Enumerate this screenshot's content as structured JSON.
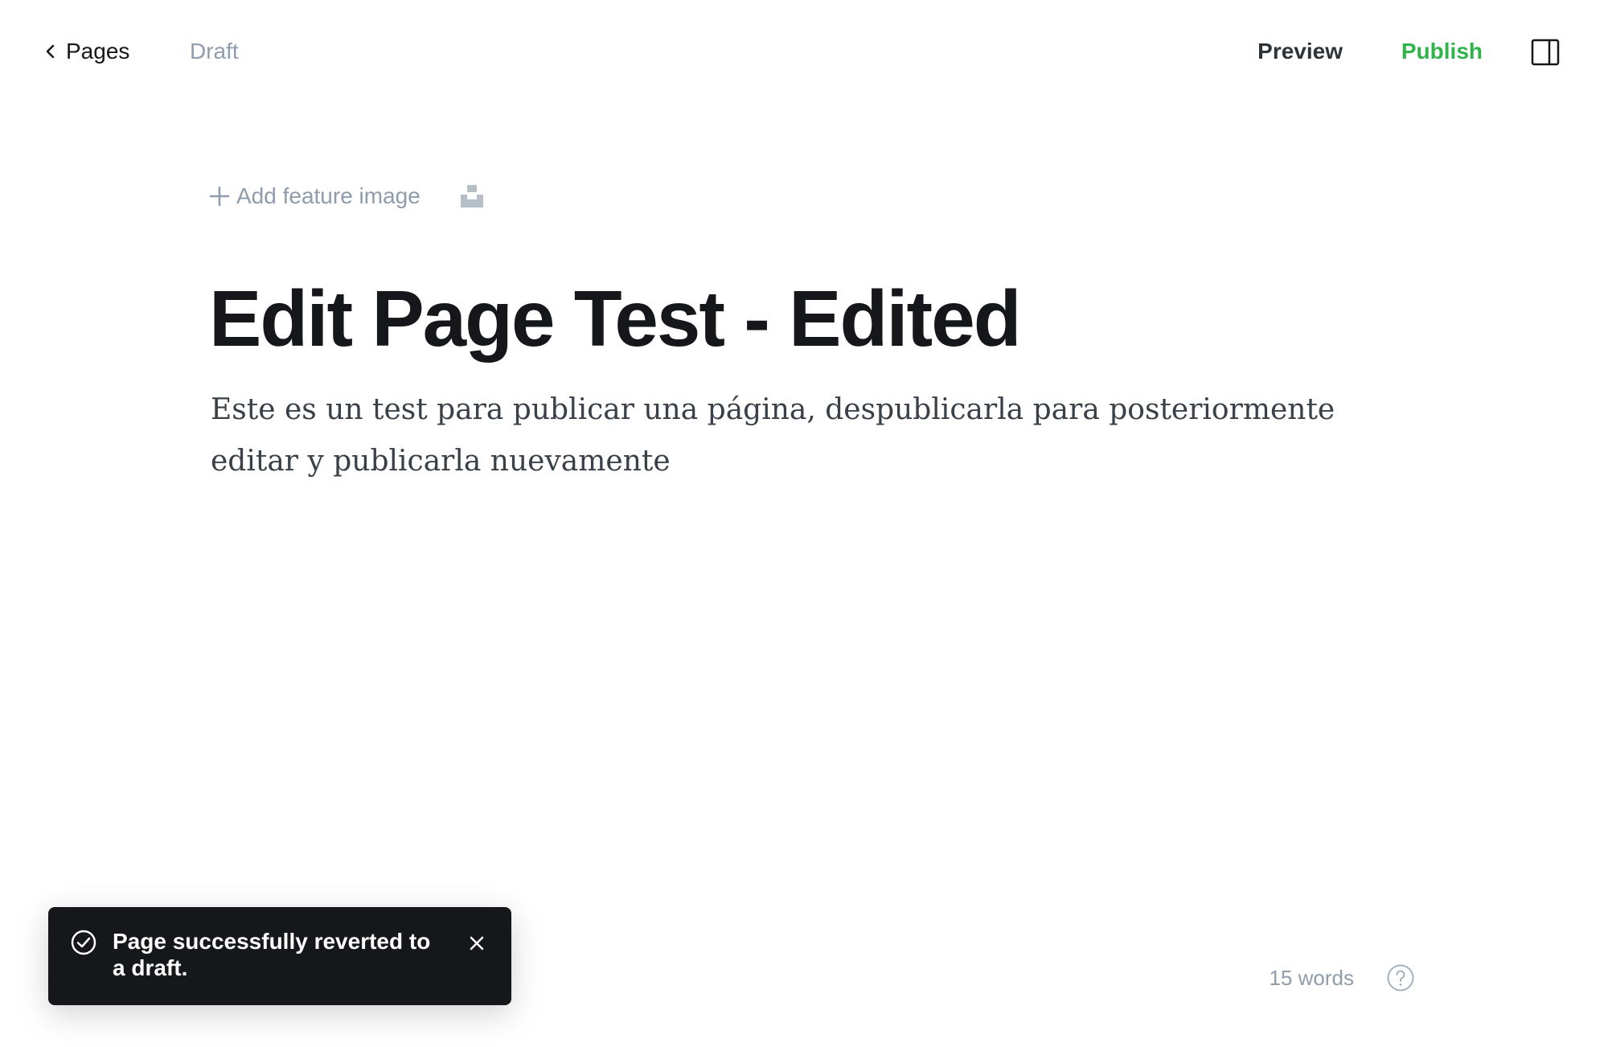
{
  "topbar": {
    "back_label": "Pages",
    "status": "Draft",
    "preview_label": "Preview",
    "publish_label": "Publish",
    "publish_color": "#30b34a"
  },
  "editor": {
    "add_feature_image_label": "Add feature image",
    "title": "Edit Page Test - Edited",
    "body": "Este es un test para publicar una página, despublicarla para posteriormente editar y publicarla nuevamente"
  },
  "toast": {
    "message": "Page successfully reverted to a draft.",
    "icon": "check-circle-icon"
  },
  "footer": {
    "word_count": "15 words",
    "help_icon": "question-circle-icon"
  },
  "icons": {
    "back": "chevron-left-icon",
    "sidebar": "sidebar-toggle-icon",
    "add": "plus-icon",
    "unsplash": "unsplash-icon",
    "close": "close-icon"
  }
}
